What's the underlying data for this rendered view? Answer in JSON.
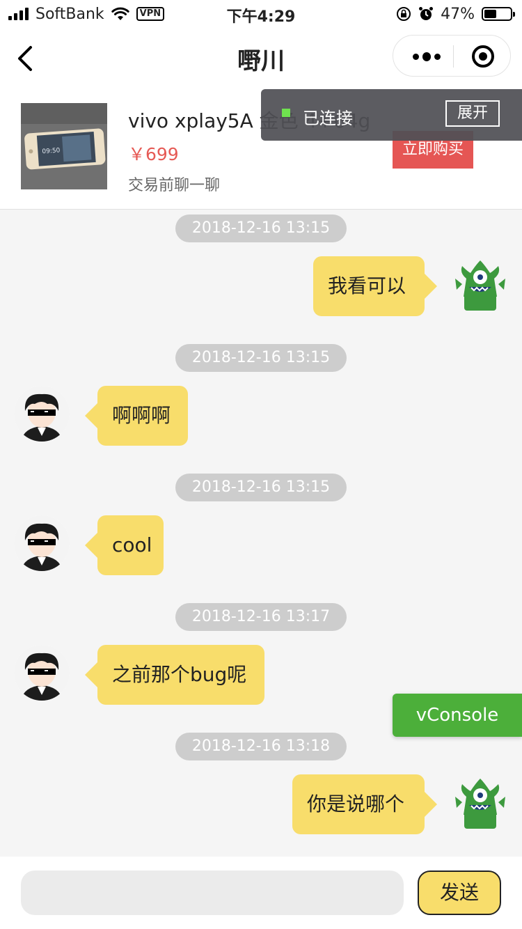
{
  "status_bar": {
    "carrier": "SoftBank",
    "vpn": "VPN",
    "time": "下午4:29",
    "battery": "47%",
    "battery_level": 0.47
  },
  "nav": {
    "title": "嘢川",
    "back_icon": "chevron-left-icon",
    "more_icon": "more-dots-icon",
    "close_icon": "target-circle-icon"
  },
  "product": {
    "title": "vivo xplay5A 金色 4+64g",
    "price": "￥699",
    "subtitle": "交易前聊一聊",
    "buy_label": "立即购买",
    "connection_status": "已连接",
    "expand_label": "展开"
  },
  "messages": [
    {
      "time": "2018-12-16 13:15",
      "side": "right",
      "text": "我看可以"
    },
    {
      "time": "2018-12-16 13:15",
      "side": "left",
      "text": "啊啊啊"
    },
    {
      "time": "2018-12-16 13:15",
      "side": "left",
      "text": "cool"
    },
    {
      "time": "2018-12-16 13:17",
      "side": "left",
      "text": "之前那个bug呢"
    },
    {
      "time": "2018-12-16 13:18",
      "side": "right",
      "text": "你是说哪个"
    }
  ],
  "vconsole_label": "vConsole",
  "composer": {
    "placeholder": "",
    "send_label": "发送"
  },
  "colors": {
    "bubble": "#f8dd6b",
    "price": "#e65a55",
    "buy_button": "#e55654",
    "vconsole": "#4caf3a",
    "monster": "#3d9a3e"
  }
}
